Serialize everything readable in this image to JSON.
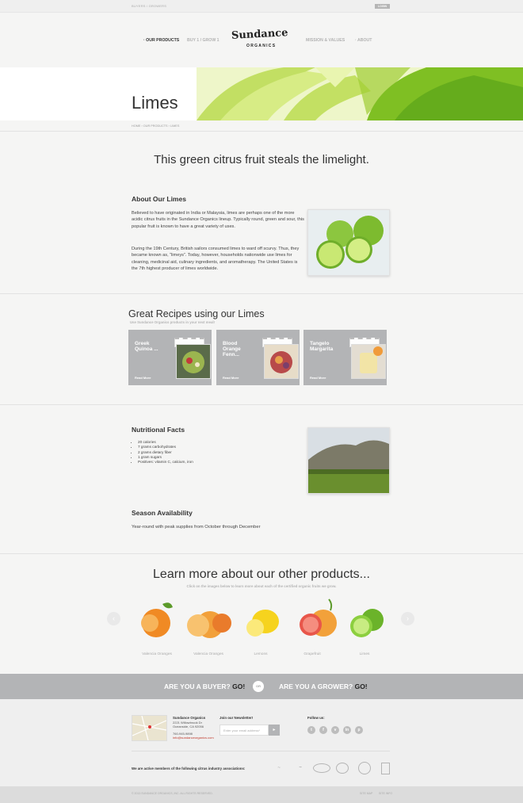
{
  "topbar": {
    "breadcrumb": "BUYERS / GROWERS",
    "login": "LOGIN"
  },
  "nav": {
    "left": [
      "OUR PRODUCTS",
      "BUY 1 / GROW 1"
    ],
    "right": [
      "MISSION & VALUES",
      "ABOUT"
    ],
    "bullet": "·"
  },
  "brand": {
    "name": "Sundance",
    "sub": "ORGANICS"
  },
  "hero": {
    "title": "Limes"
  },
  "breadcrumb": [
    "HOME",
    "OUR PRODUCTS",
    "LIMES"
  ],
  "tagline": "This green citrus fruit steals the limelight.",
  "about": {
    "heading": "About Our Limes",
    "p1": "Believed to have originated in India or Malaysia, limes are perhaps one of the more acidic citrus fruits in the Sundance Organics lineup. Typically round, green and sour, this popular fruit is known to have a great variety of uses.",
    "p2": "During the 19th Century, British sailors consumed limes to ward off scurvy. Thus, they became known as, “limeys”. Today, however, households nationwide use limes for cleaning, medicinal aid, culinary ingredients, and aromatherapy. The United States is the 7th highest producer of limes worldwide."
  },
  "recipes": {
    "heading": "Great Recipes using our Limes",
    "sub": "Use Sundance Organics products in your next meal!",
    "items": [
      {
        "title": "Greek Quinoa ...",
        "more": "Read More"
      },
      {
        "title": "Blood Orange Fenn...",
        "more": "Read More"
      },
      {
        "title": "Tangelo Margarita",
        "more": "Read More"
      }
    ]
  },
  "nutrition": {
    "heading": "Nutritional Facts",
    "items": [
      "20 calories",
      "7 grams carbohydrates",
      "2 grams dietary fiber",
      "1 gram sugars",
      "Positives: vitamin C, calcium, iron"
    ]
  },
  "season": {
    "heading": "Season Availability",
    "text": "Year-round with peak supplies from October through December"
  },
  "learn": {
    "heading": "Learn more about our other products...",
    "sub": "Click on the images below to learn more about each of the certified organic fruits we grow.",
    "fruits": [
      "Valencia Oranges",
      "Valencia Oranges",
      "Lemons",
      "Grapefruit",
      "Limes"
    ]
  },
  "cta": {
    "buyer": "ARE YOU A BUYER?",
    "grower": "ARE YOU A GROWER?",
    "go": "GO!",
    "or": "OR"
  },
  "footer": {
    "company": "Sundance Organics",
    "addr1": "2221 Willowbrook Dr",
    "addr2": "Oceanside, CA 92056",
    "phone": "760-945-9898",
    "email": "info@sundanceorganics.com",
    "newsletter": "Join our Newsletter!",
    "email_placeholder": "Enter your email address*",
    "follow": "Follow us:",
    "assoc": "We are active members of the following citrus industry associations:",
    "copyright": "© 2013 SUNDANCE ORGANICS, INC. ALL RIGHTS RESERVED.",
    "links": [
      "SITE MAP",
      "SITE INFO"
    ]
  }
}
